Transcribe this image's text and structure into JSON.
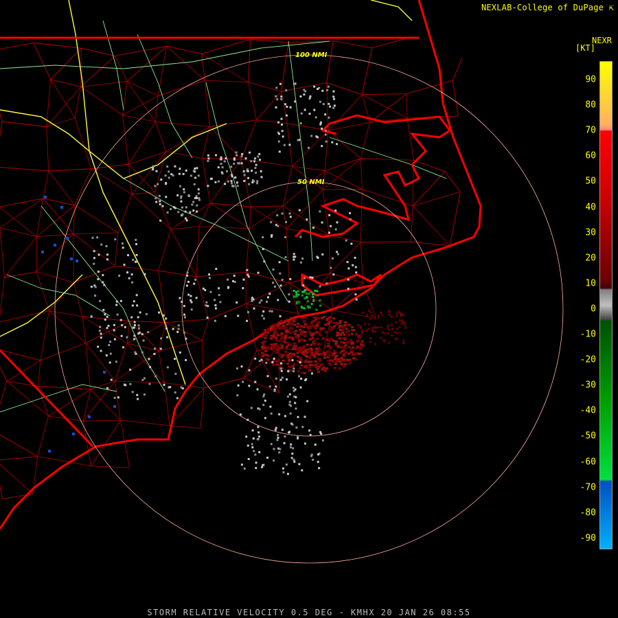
{
  "header": {
    "credit": "NEXLAB-College of DuPage ⇱"
  },
  "legend": {
    "product": "NEXR",
    "units": "[KT]",
    "ticks": [
      "90",
      "80",
      "70",
      "60",
      "50",
      "40",
      "30",
      "20",
      "10",
      "0",
      "-10",
      "-20",
      "-30",
      "-40",
      "-50",
      "-60",
      "-70",
      "-80",
      "-90"
    ],
    "colors": {
      "outbound_high": "#ffff00",
      "outbound_mid": "#ff0000",
      "outbound_low": "#6a0000",
      "near_zero": "#c0c0c0",
      "inbound_low": "#005000",
      "inbound_mid": "#00e040",
      "inbound_high": "#0050c0",
      "inbound_max": "#00b0ff"
    }
  },
  "map": {
    "range_rings": [
      {
        "label": "100 NMI"
      },
      {
        "label": "50 NMI"
      }
    ],
    "colors": {
      "state_border": "#ff0000",
      "county_border": "#cc0000",
      "coast": "#ff2020",
      "highway": "#ffff40",
      "road": "#90ee90",
      "ring": "#ffb0a0"
    }
  },
  "caption": "STORM RELATIVE VELOCITY 0.5 DEG - KMHX 20 JAN 26 08:55"
}
